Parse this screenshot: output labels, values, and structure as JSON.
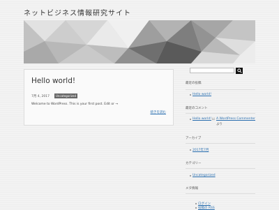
{
  "site": {
    "title": "ネットビジネス情報研究サイト"
  },
  "post": {
    "title": "Hello world!",
    "date": "7月 4, 2017",
    "category": "Uncategorized",
    "excerpt": "Welcome to WordPress. This is your first post. Edit or →",
    "read_more": "続きを読む"
  },
  "sidebar": {
    "search": {
      "placeholder": ""
    },
    "recent_posts": {
      "title": "最近の投稿",
      "items": [
        "Hello world!"
      ]
    },
    "recent_comments": {
      "title": "最近のコメント",
      "author_1": "Hello world!",
      "separator": "に",
      "author_2": "A WordPress Commenter",
      "suffix": "より"
    },
    "archives": {
      "title": "アーカイブ",
      "items": [
        "2017年7月"
      ]
    },
    "categories": {
      "title": "カテゴリー",
      "items": [
        "Uncategorized"
      ]
    },
    "meta": {
      "title": "メタ情報",
      "items": [
        "ログイン",
        "投稿の RSS"
      ]
    }
  },
  "colors": {
    "link": "#2a6fb0",
    "badge": "#666666"
  }
}
